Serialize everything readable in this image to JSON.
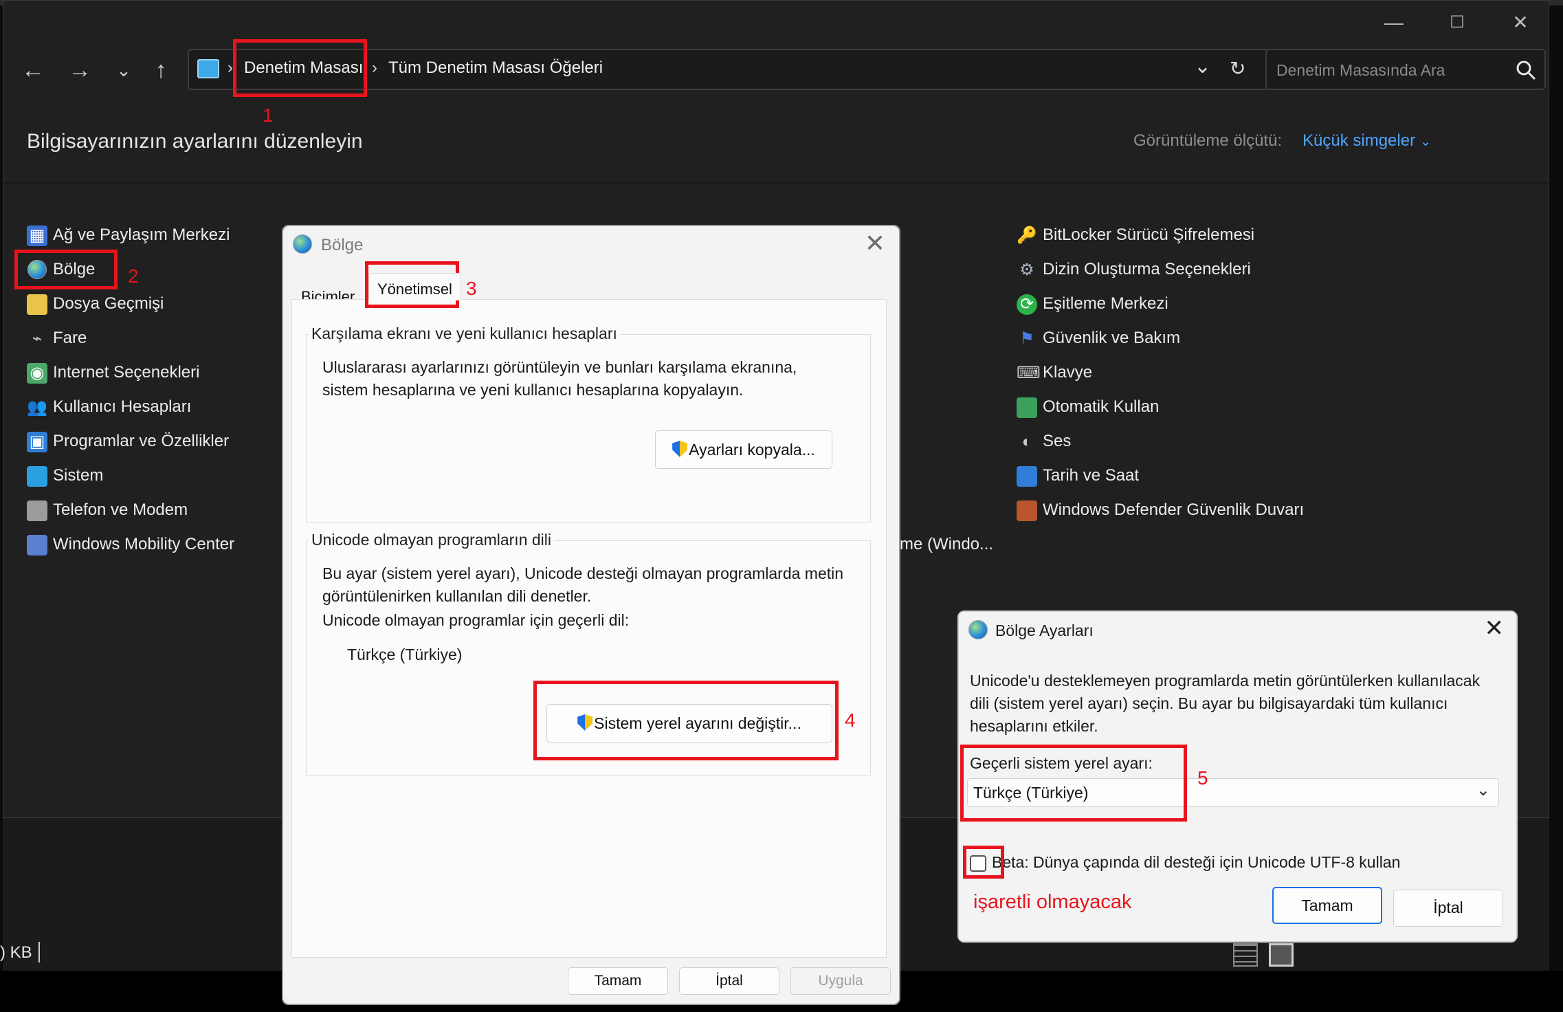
{
  "window": {
    "controls": {
      "minimize": "—",
      "maximize": "☐",
      "close": "✕"
    },
    "address": {
      "crumbs": [
        "Denetim Masası",
        "Tüm Denetim Masası Öğeleri"
      ],
      "separator": "›"
    },
    "search": {
      "placeholder": "Denetim Masasında Ara"
    },
    "heading": "Bilgisayarınızın ayarlarını düzenleyin",
    "view_by_label": "Görüntüleme ölçütü:",
    "view_by_value": "Küçük simgeler",
    "left_items": [
      {
        "label": "Ağ ve Paylaşım Merkezi",
        "icon": "network-icon"
      },
      {
        "label": "Bölge",
        "icon": "globe-icon"
      },
      {
        "label": "Dosya Geçmişi",
        "icon": "file-history-icon"
      },
      {
        "label": "Fare",
        "icon": "mouse-icon"
      },
      {
        "label": "Internet Seçenekleri",
        "icon": "internet-options-icon"
      },
      {
        "label": "Kullanıcı Hesapları",
        "icon": "users-icon"
      },
      {
        "label": "Programlar ve Özellikler",
        "icon": "programs-icon"
      },
      {
        "label": "Sistem",
        "icon": "system-icon"
      },
      {
        "label": "Telefon ve Modem",
        "icon": "phone-icon"
      },
      {
        "label": "Windows Mobility Center",
        "icon": "mobility-icon"
      }
    ],
    "right_items": [
      {
        "label": "BitLocker Sürücü Şifrelemesi",
        "icon": "bitlocker-icon"
      },
      {
        "label": "Dizin Oluşturma Seçenekleri",
        "icon": "indexing-icon"
      },
      {
        "label": "Eşitleme Merkezi",
        "icon": "sync-icon"
      },
      {
        "label": "Güvenlik ve Bakım",
        "icon": "flag-icon"
      },
      {
        "label": "Klavye",
        "icon": "keyboard-icon"
      },
      {
        "label": "Otomatik Kullan",
        "icon": "autoplay-icon"
      },
      {
        "label": "Ses",
        "icon": "sound-icon"
      },
      {
        "label": "Tarih ve Saat",
        "icon": "clock-icon"
      },
      {
        "label": "Windows Defender Güvenlik Duvarı",
        "icon": "firewall-icon"
      }
    ],
    "partial_item": "me (Windo...",
    "statusbar": {
      "size_text": ") KB"
    }
  },
  "bolge_dialog": {
    "title": "Bölge",
    "tabs": [
      "Biçimler",
      "Yönetimsel"
    ],
    "group1": {
      "label": "Karşılama ekranı ve yeni kullanıcı hesapları",
      "text": "Uluslararası ayarlarınızı görüntüleyin ve bunları karşılama ekranına, sistem hesaplarına ve yeni kullanıcı hesaplarına kopyalayın.",
      "button": "Ayarları kopyala..."
    },
    "group2": {
      "label": "Unicode olmayan programların dili",
      "text": "Bu ayar (sistem yerel ayarı), Unicode desteği olmayan programlarda metin görüntülenirken kullanılan dili denetler.",
      "current_label": "Unicode olmayan programlar için geçerli dil:",
      "current_value": "Türkçe (Türkiye)",
      "button": "Sistem yerel ayarını değiştir..."
    },
    "footer": {
      "ok": "Tamam",
      "cancel": "İptal",
      "apply": "Uygula"
    }
  },
  "bolge_ayarlari_dialog": {
    "title": "Bölge Ayarları",
    "description": "Unicode'u desteklemeyen programlarda metin görüntülerken kullanılacak dili (sistem yerel ayarı) seçin. Bu ayar bu bilgisayardaki tüm kullanıcı hesaplarını etkiler.",
    "select_label": "Geçerli sistem yerel ayarı:",
    "select_value": "Türkçe (Türkiye)",
    "beta_prefix": "Beta:",
    "beta_text": "Dünya çapında dil desteği için Unicode UTF-8 kullan",
    "beta_checked": false,
    "ok": "Tamam",
    "cancel": "İptal"
  },
  "annotations": {
    "numbers": [
      "1",
      "2",
      "3",
      "4",
      "5"
    ],
    "note": "işaretli olmayacak",
    "color": "#e8141d"
  }
}
